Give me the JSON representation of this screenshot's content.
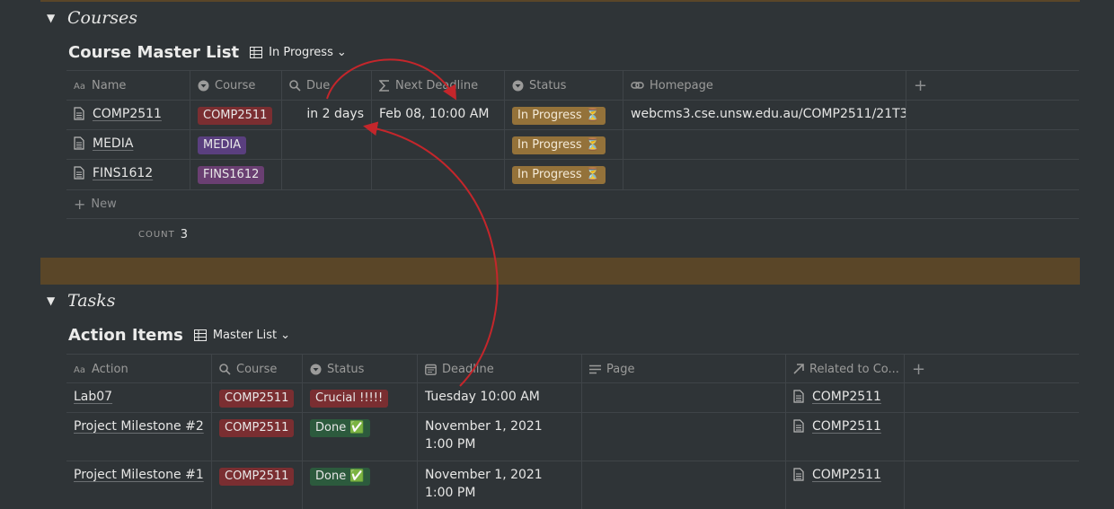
{
  "courses_section": {
    "title": "Courses"
  },
  "course_db": {
    "title": "Course Master List",
    "view": "In Progress",
    "columns": [
      "Name",
      "Course",
      "Due",
      "Next Deadline",
      "Status",
      "Homepage"
    ],
    "rows": [
      {
        "name": "COMP2511",
        "course": "COMP2511",
        "due": "in 2 days",
        "next_deadline": "Feb 08, 10:00 AM",
        "status": "In Progress ⏳",
        "homepage": "webcms3.cse.unsw.edu.au/COMP2511/21T3/"
      },
      {
        "name": "MEDIA",
        "course": "MEDIA",
        "due": "",
        "next_deadline": "",
        "status": "In Progress ⏳",
        "homepage": ""
      },
      {
        "name": "FINS1612",
        "course": "FINS1612",
        "due": "",
        "next_deadline": "",
        "status": "In Progress ⏳",
        "homepage": ""
      }
    ],
    "new_label": "New",
    "count_label": "COUNT",
    "count_value": "3"
  },
  "tasks_section": {
    "title": "Tasks"
  },
  "tasks_db": {
    "title": "Action Items",
    "view": "Master List",
    "columns": [
      "Action",
      "Course",
      "Status",
      "Deadline",
      "Page",
      "Related to Co..."
    ],
    "rows": [
      {
        "action": "Lab07",
        "course": "COMP2511",
        "status": "Crucial !!!!!",
        "deadline": "Tuesday 10:00 AM",
        "page": "",
        "related": "COMP2511"
      },
      {
        "action": "Project Milestone #2",
        "course": "COMP2511",
        "status": "Done ✅",
        "deadline": "November 1, 2021 1:00 PM",
        "page": "",
        "related": "COMP2511"
      },
      {
        "action": "Project Milestone #1",
        "course": "COMP2511",
        "status": "Done ✅",
        "deadline": "November 1, 2021 1:00 PM",
        "page": "",
        "related": "COMP2511"
      }
    ]
  },
  "colors": {
    "background": "#2f3437",
    "section_bar": "#5a4628",
    "tag_red": "#7a2e31",
    "tag_purple": "#5a3f7f",
    "tag_gold": "#94723a",
    "tag_green": "#2c5a3d",
    "annotation_arrow": "#c4262b"
  }
}
